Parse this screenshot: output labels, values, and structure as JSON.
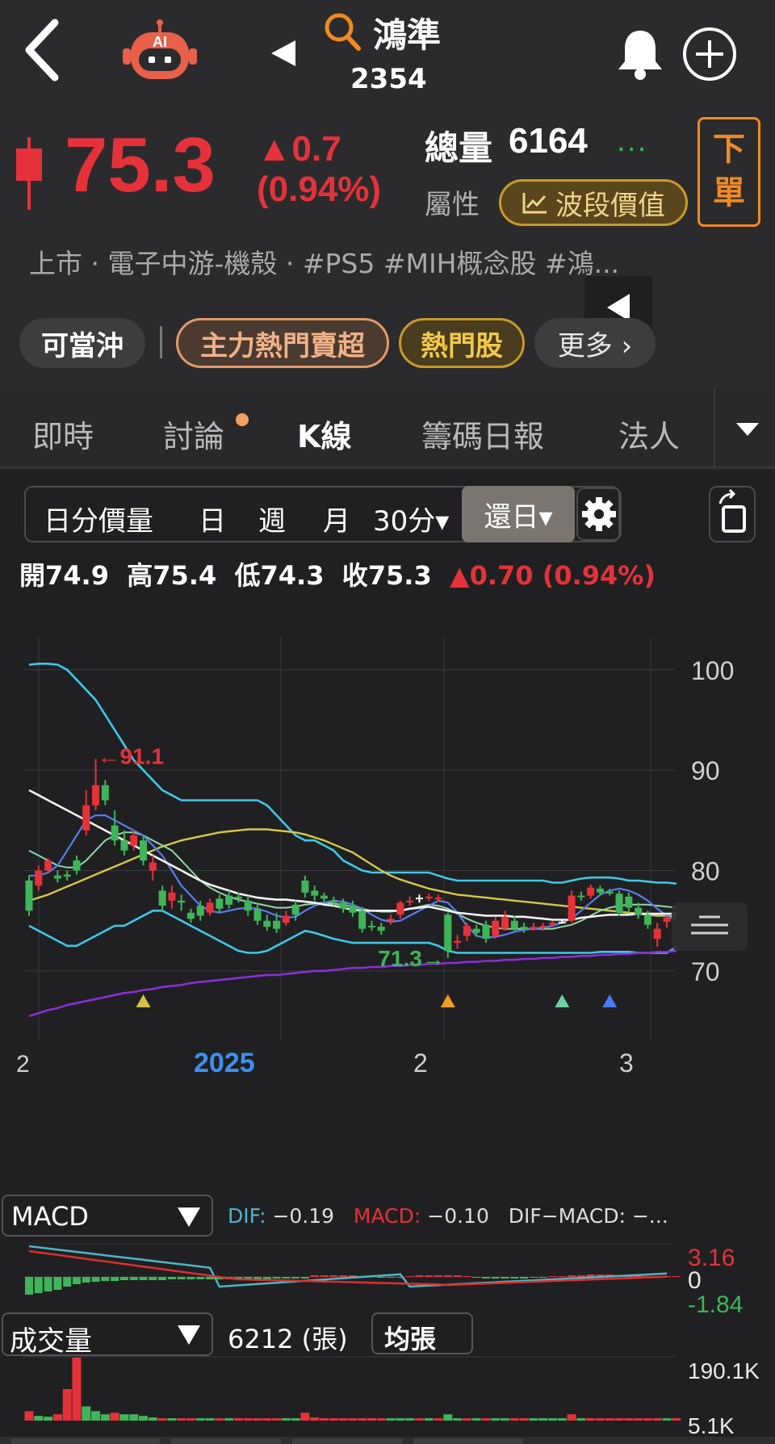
{
  "header": {
    "stock_name": "鴻準",
    "stock_code": "2354",
    "ai_label": "AI"
  },
  "quote": {
    "price": "75.3",
    "change": "▲0.7",
    "change_pct": "(0.94%)",
    "volume_label": "總量",
    "volume_value": "6164",
    "more_dots": "...",
    "attr_label": "屬性",
    "wave_button": "波段價值",
    "order_button_line1": "下",
    "order_button_line2": "單",
    "tags": "上市 · 電子中游-機殼 · #PS5 #MIH概念股 #鴻...",
    "color_up": "#e5323a",
    "color_down": "#3fb55a"
  },
  "chips": {
    "c1": "可當沖",
    "c2": "主力熱門賣超",
    "c3": "熱門股",
    "c4": "更多 ›"
  },
  "tabs": [
    "即時",
    "討論",
    "K線",
    "籌碼日報",
    "法人"
  ],
  "periods": {
    "p1": "日分價量",
    "p2": "日",
    "p3": "週",
    "p4": "月",
    "p5": "30分▾",
    "active": "還日▾"
  },
  "ohlc": {
    "open": "開74.9",
    "high": "高75.4",
    "low": "低74.3",
    "close": "收75.3",
    "change": "▲0.70 (0.94%)"
  },
  "chart_data": {
    "type": "candlestick",
    "y_ticks": [
      "100",
      "90",
      "80",
      "70"
    ],
    "ylim": [
      63,
      104
    ],
    "x_labels": [
      "2025",
      "2",
      "3"
    ],
    "left_edge_label": "2",
    "annotations": {
      "high": "←91.1",
      "low": "71.3→"
    },
    "candles": [
      {
        "o": 79,
        "c": 76,
        "h": 79.5,
        "l": 75.5
      },
      {
        "o": 78.5,
        "c": 80,
        "h": 80.5,
        "l": 78
      },
      {
        "o": 80,
        "c": 81,
        "h": 81.2,
        "l": 79.8
      },
      {
        "o": 79.5,
        "c": 79.2,
        "h": 80,
        "l": 78.8
      },
      {
        "o": 79.6,
        "c": 79.4,
        "h": 80,
        "l": 79
      },
      {
        "o": 81,
        "c": 80,
        "h": 81.5,
        "l": 79.6
      },
      {
        "o": 84,
        "c": 86.5,
        "h": 88,
        "l": 83.5
      },
      {
        "o": 86.5,
        "c": 88.5,
        "h": 91.1,
        "l": 86
      },
      {
        "o": 88.5,
        "c": 87,
        "h": 89,
        "l": 86.5
      },
      {
        "o": 84.5,
        "c": 83,
        "h": 86,
        "l": 82.5
      },
      {
        "o": 83,
        "c": 82,
        "h": 84,
        "l": 81.5
      },
      {
        "o": 82.5,
        "c": 83.5,
        "h": 84,
        "l": 82
      },
      {
        "o": 83,
        "c": 81,
        "h": 83.5,
        "l": 80.5
      },
      {
        "o": 80,
        "c": 80.8,
        "h": 81.5,
        "l": 79
      },
      {
        "o": 78,
        "c": 76.5,
        "h": 78.5,
        "l": 76
      },
      {
        "o": 77,
        "c": 77.8,
        "h": 78.5,
        "l": 76.2
      },
      {
        "o": 77,
        "c": 76.8,
        "h": 77.6,
        "l": 76
      },
      {
        "o": 75.8,
        "c": 75.2,
        "h": 76.2,
        "l": 74.8
      },
      {
        "o": 76.5,
        "c": 75.5,
        "h": 77,
        "l": 75
      },
      {
        "o": 75.8,
        "c": 76.8,
        "h": 77.2,
        "l": 75.5
      },
      {
        "o": 77.2,
        "c": 76.2,
        "h": 77.6,
        "l": 75.8
      },
      {
        "o": 77.5,
        "c": 76.6,
        "h": 78,
        "l": 76.2
      },
      {
        "o": 77.4,
        "c": 77.2,
        "h": 77.8,
        "l": 76.8
      },
      {
        "o": 77,
        "c": 76,
        "h": 77.5,
        "l": 75.5
      },
      {
        "o": 76.2,
        "c": 75,
        "h": 76.8,
        "l": 74.6
      },
      {
        "o": 75,
        "c": 74.4,
        "h": 75.6,
        "l": 74
      },
      {
        "o": 75,
        "c": 74.2,
        "h": 75.8,
        "l": 73.8
      },
      {
        "o": 74.8,
        "c": 75.5,
        "h": 76,
        "l": 74.5
      },
      {
        "o": 76.6,
        "c": 75.6,
        "h": 77,
        "l": 75
      },
      {
        "o": 79,
        "c": 77.8,
        "h": 79.5,
        "l": 77.3
      },
      {
        "o": 78,
        "c": 77.5,
        "h": 78.5,
        "l": 77
      },
      {
        "o": 77.5,
        "c": 77.2,
        "h": 77.8,
        "l": 76.8
      },
      {
        "o": 77,
        "c": 76.8,
        "h": 77.4,
        "l": 76.5
      },
      {
        "o": 76.8,
        "c": 76.2,
        "h": 77.2,
        "l": 75.8
      },
      {
        "o": 76.5,
        "c": 75.8,
        "h": 77,
        "l": 75.4
      },
      {
        "o": 76,
        "c": 74.2,
        "h": 76.4,
        "l": 73.8
      },
      {
        "o": 74.5,
        "c": 74.4,
        "h": 75,
        "l": 74
      },
      {
        "o": 74.4,
        "c": 74,
        "h": 74.8,
        "l": 73.6
      },
      {
        "o": 75,
        "c": 75.2,
        "h": 75.6,
        "l": 74.6
      },
      {
        "o": 75.6,
        "c": 76.8,
        "h": 77,
        "l": 75.2
      },
      {
        "o": 76.9,
        "c": 77,
        "h": 77.4,
        "l": 76.5
      },
      {
        "o": 77.3,
        "c": 77.3,
        "h": 77.6,
        "l": 76.8
      },
      {
        "o": 77.3,
        "c": 77.4,
        "h": 77.7,
        "l": 77
      },
      {
        "o": 77.2,
        "c": 77.3,
        "h": 77.6,
        "l": 76.9
      },
      {
        "o": 75.6,
        "c": 72,
        "h": 75.8,
        "l": 71.3
      },
      {
        "o": 72.8,
        "c": 73,
        "h": 73.6,
        "l": 72.2
      },
      {
        "o": 73.5,
        "c": 74.5,
        "h": 74.8,
        "l": 73
      },
      {
        "o": 74.2,
        "c": 73.8,
        "h": 74.6,
        "l": 73.4
      },
      {
        "o": 74.6,
        "c": 73.2,
        "h": 75,
        "l": 72.8
      },
      {
        "o": 73.5,
        "c": 75,
        "h": 75.4,
        "l": 73.2
      },
      {
        "o": 74.2,
        "c": 75.4,
        "h": 76,
        "l": 74
      },
      {
        "o": 75,
        "c": 74.2,
        "h": 75.5,
        "l": 74
      },
      {
        "o": 74.4,
        "c": 74.2,
        "h": 74.8,
        "l": 73.8
      },
      {
        "o": 74.2,
        "c": 74.4,
        "h": 74.8,
        "l": 74
      },
      {
        "o": 74.3,
        "c": 74.5,
        "h": 74.8,
        "l": 74
      },
      {
        "o": 74.6,
        "c": 74.8,
        "h": 75,
        "l": 74.4
      },
      {
        "o": 74.9,
        "c": 74.9,
        "h": 75.1,
        "l": 74.7
      },
      {
        "o": 75,
        "c": 77.5,
        "h": 78,
        "l": 74.8
      },
      {
        "o": 77.5,
        "c": 77.4,
        "h": 77.9,
        "l": 77
      },
      {
        "o": 77.5,
        "c": 78.3,
        "h": 78.6,
        "l": 77.2
      },
      {
        "o": 78.2,
        "c": 77.8,
        "h": 78.5,
        "l": 77.5
      },
      {
        "o": 77.9,
        "c": 77.7,
        "h": 78.2,
        "l": 77.5
      },
      {
        "o": 77.7,
        "c": 75.8,
        "h": 78,
        "l": 75.5
      },
      {
        "o": 77.4,
        "c": 76.3,
        "h": 77.8,
        "l": 75.8
      },
      {
        "o": 76.3,
        "c": 75.6,
        "h": 76.8,
        "l": 75.2
      },
      {
        "o": 75.6,
        "c": 74.6,
        "h": 76,
        "l": 74.2
      },
      {
        "o": 73.2,
        "c": 74.2,
        "h": 74.8,
        "l": 72.4
      },
      {
        "o": 74.9,
        "c": 75.3,
        "h": 75.4,
        "l": 74.3
      }
    ],
    "lines": {
      "bb_upper": [
        100.5,
        100.6,
        100.6,
        100.5,
        100,
        99,
        98,
        97,
        95.5,
        94,
        92.5,
        91,
        90,
        89,
        88,
        87.5,
        87,
        87,
        87,
        87,
        87,
        87,
        87,
        87,
        87,
        86.5,
        85.5,
        84.5,
        83.5,
        83,
        83,
        82.5,
        82,
        81,
        80.5,
        80,
        79.8,
        79.8,
        79.8,
        79.8,
        79.8,
        79.8,
        79.8,
        79.5,
        79.2,
        79,
        79,
        79,
        79,
        79,
        79,
        79,
        79,
        79,
        79,
        78.8,
        78.8,
        79,
        79.2,
        79.3,
        79.3,
        79.3,
        79.2,
        79,
        79,
        78.9,
        78.8,
        78.8,
        78.7
      ],
      "bb_mid": [
        88,
        87.5,
        87,
        86.5,
        86,
        85.5,
        85,
        84.5,
        84,
        83.5,
        83,
        82.5,
        82,
        81.5,
        81,
        80.5,
        80,
        79.5,
        79,
        78.6,
        78.3,
        78,
        77.7,
        77.5,
        77.3,
        77.2,
        77.1,
        77.1,
        77,
        76.9,
        76.8,
        76.6,
        76.5,
        76.3,
        76.1,
        76,
        76,
        76,
        76,
        76,
        76.2,
        76.3,
        76.4,
        76.2,
        76,
        75.8,
        75.7,
        75.6,
        75.5,
        75.5,
        75.5,
        75.4,
        75.4,
        75.3,
        75.2,
        75.1,
        75.1,
        75.1,
        75.3,
        75.4,
        75.5,
        75.6,
        75.6,
        75.6,
        75.7,
        75.7,
        75.7,
        75.7,
        75.7
      ],
      "bb_lower": [
        74.5,
        74,
        73.5,
        73,
        72.5,
        72.5,
        73,
        73.5,
        74,
        74.5,
        74.5,
        75,
        75.5,
        76,
        76,
        75.5,
        75,
        74.5,
        74,
        73.5,
        73,
        72.5,
        72,
        71.8,
        71.8,
        72,
        72.5,
        73,
        73.5,
        74,
        73.8,
        73.5,
        73.2,
        73,
        72.8,
        72.8,
        72.8,
        72.8,
        72.8,
        72.8,
        72.8,
        72.8,
        72.8,
        72.5,
        72,
        71.8,
        71.8,
        71.8,
        71.8,
        71.8,
        71.8,
        71.8,
        71.8,
        71.8,
        71.8,
        71.8,
        71.8,
        71.8,
        71.8,
        71.8,
        71.9,
        71.9,
        71.9,
        71.9,
        71.8,
        71.8,
        71.8,
        71.8,
        72.4
      ],
      "ma_yellow": [
        77,
        77.3,
        77.6,
        78,
        78.4,
        78.8,
        79.2,
        79.6,
        80,
        80.4,
        80.8,
        81.2,
        81.6,
        82,
        82.4,
        82.7,
        83,
        83.2,
        83.4,
        83.6,
        83.8,
        83.9,
        84,
        84.1,
        84.1,
        84.1,
        84,
        83.9,
        83.8,
        83.6,
        83.3,
        83,
        82.6,
        82.2,
        81.8,
        81.2,
        80.6,
        80,
        79.5,
        79.1,
        78.8,
        78.5,
        78.2,
        78,
        77.8,
        77.6,
        77.5,
        77.4,
        77.3,
        77.2,
        77.1,
        77,
        76.9,
        76.8,
        76.7,
        76.6,
        76.5,
        76.4,
        76.3,
        76.2,
        76.1,
        76,
        75.9,
        75.8,
        75.7,
        75.6,
        75.5,
        75.5,
        75.4
      ],
      "ma_green": [
        82,
        81.5,
        81,
        80.5,
        80.3,
        80.3,
        81,
        82,
        83,
        83.5,
        83.8,
        83.8,
        83.5,
        83,
        82.5,
        82,
        81,
        80,
        79,
        78.3,
        77.8,
        77.4,
        77.1,
        76.9,
        76.7,
        76.5,
        76.3,
        76.3,
        76.4,
        76.6,
        76.7,
        76.8,
        76.7,
        76.6,
        76.4,
        76.2,
        76,
        75.9,
        75.9,
        76,
        76.2,
        76.4,
        76.6,
        76.5,
        76.2,
        75.7,
        75.2,
        74.8,
        74.5,
        74.3,
        74.2,
        74.2,
        74.2,
        74.2,
        74.2,
        74.2,
        74.4,
        74.6,
        75,
        75.5,
        76,
        76.3,
        76.5,
        76.6,
        76.6,
        76.6,
        76.5,
        76.4,
        76.3
      ],
      "ma_blue": [
        79.5,
        79.5,
        79.8,
        80.5,
        82,
        83.5,
        85,
        85.5,
        85.5,
        85,
        84.5,
        84,
        83.5,
        82.5,
        81.5,
        80,
        78.5,
        77.5,
        76.5,
        76,
        75.8,
        76,
        76.2,
        76.3,
        76.2,
        75.9,
        75.5,
        75.3,
        75.4,
        76,
        76.5,
        76.8,
        77,
        76.9,
        76.6,
        76.2,
        75.6,
        75.1,
        74.9,
        75,
        75.5,
        76,
        76.5,
        77,
        76.8,
        75.8,
        74.5,
        73.5,
        73.3,
        73.4,
        73.6,
        73.9,
        74.1,
        74.2,
        74.3,
        74.5,
        74.8,
        75.2,
        76,
        76.8,
        77.6,
        78,
        78.2,
        78,
        77.6,
        77,
        76.2,
        75.5,
        75
      ],
      "ma_purple": [
        65.5,
        65.8,
        66.1,
        66.3,
        66.6,
        66.8,
        67,
        67.2,
        67.4,
        67.6,
        67.8,
        67.9,
        68.1,
        68.2,
        68.4,
        68.5,
        68.6,
        68.8,
        68.9,
        69,
        69.1,
        69.2,
        69.3,
        69.4,
        69.5,
        69.6,
        69.6,
        69.7,
        69.8,
        69.9,
        70,
        70,
        70.1,
        70.2,
        70.3,
        70.3,
        70.4,
        70.4,
        70.5,
        70.5,
        70.6,
        70.6,
        70.7,
        70.7,
        70.8,
        70.8,
        70.9,
        70.9,
        71,
        71,
        71.1,
        71.1,
        71.2,
        71.2,
        71.3,
        71.3,
        71.4,
        71.4,
        71.5,
        71.5,
        71.6,
        71.6,
        71.7,
        71.7,
        71.8,
        71.8,
        71.9,
        71.9,
        72
      ]
    },
    "markers": [
      {
        "index": 12,
        "color": "#d4c24a"
      },
      {
        "index": 44,
        "color": "#f0a020"
      },
      {
        "index": 56,
        "color": "#6fcfa0"
      },
      {
        "index": 61,
        "color": "#4a7af0"
      }
    ]
  },
  "macd": {
    "name": "MACD",
    "dif_label": "DIF:",
    "dif_value": "−0.19",
    "macd_label": "MACD:",
    "macd_value": "−0.10",
    "diff_label": "DIF−MACD: −...",
    "axis_top": "3.16",
    "axis_zero": "0",
    "axis_bottom": "-1.84"
  },
  "volume": {
    "name": "成交量",
    "value": "6212 (張)",
    "mode": "均張",
    "axis_top": "190.1K",
    "axis_bottom": "5.1K",
    "bars": [
      12,
      6,
      5,
      8,
      40,
      80,
      18,
      12,
      8,
      10,
      8,
      8,
      6,
      4,
      3,
      3,
      3,
      3,
      3,
      3,
      3,
      3,
      3,
      3,
      3,
      3,
      3,
      3,
      3,
      10,
      4,
      3,
      3,
      3,
      3,
      3,
      3,
      3,
      3,
      3,
      3,
      3,
      3,
      3,
      8,
      3,
      3,
      3,
      3,
      3,
      3,
      3,
      3,
      3,
      3,
      3,
      3,
      8,
      3,
      3,
      3,
      3,
      3,
      3,
      3,
      3,
      3,
      3,
      3
    ],
    "ups": [
      1,
      0,
      0,
      1,
      1,
      1,
      0,
      0,
      0,
      1,
      0,
      0,
      0,
      0,
      1,
      0,
      1,
      1,
      0,
      0,
      1,
      0,
      1,
      1,
      1,
      1,
      1,
      0,
      0,
      1,
      1,
      1,
      1,
      1,
      1,
      1,
      1,
      1,
      0,
      0,
      0,
      1,
      0,
      1,
      0,
      0,
      1,
      0,
      1,
      0,
      0,
      1,
      1,
      0,
      0,
      0,
      0,
      1,
      0,
      1,
      1,
      1,
      1,
      1,
      1,
      1,
      1,
      0,
      1
    ]
  }
}
